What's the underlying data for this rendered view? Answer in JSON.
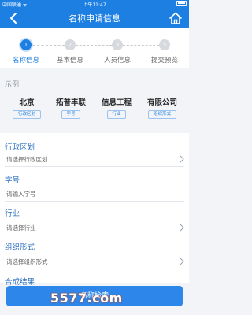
{
  "status": {
    "carrier": "中国联通 ᯤ",
    "time": "上午11:47"
  },
  "nav": {
    "title": "名称申请信息"
  },
  "steps": [
    {
      "num": "1",
      "label": "名称信息",
      "active": true
    },
    {
      "num": "2",
      "label": "基本信息",
      "active": false
    },
    {
      "num": "3",
      "label": "人员信息",
      "active": false
    },
    {
      "num": "5",
      "label": "提交预览",
      "active": false
    }
  ],
  "example": {
    "title": "示例",
    "items": [
      {
        "word": "北京",
        "tag": "行政区划"
      },
      {
        "word": "拓普丰联",
        "tag": "字号"
      },
      {
        "word": "信息工程",
        "tag": "行业"
      },
      {
        "word": "有限公司",
        "tag": "组织形式"
      }
    ]
  },
  "fields": [
    {
      "label": "行政区划",
      "placeholder": "请选择行政区划",
      "has_chevron": true
    },
    {
      "label": "字号",
      "placeholder": "请输入字号",
      "has_chevron": false
    },
    {
      "label": "行业",
      "placeholder": "请选择行业",
      "has_chevron": true
    },
    {
      "label": "组织形式",
      "placeholder": "请选择组织形式",
      "has_chevron": true
    }
  ],
  "result": {
    "label": "合成结果"
  },
  "submit": {
    "label": "名称检索"
  },
  "watermark": "5577.com",
  "colors": {
    "primary": "#1e7fe3",
    "label": "#2b6fbf",
    "inactive_step": "#d6d9de"
  }
}
